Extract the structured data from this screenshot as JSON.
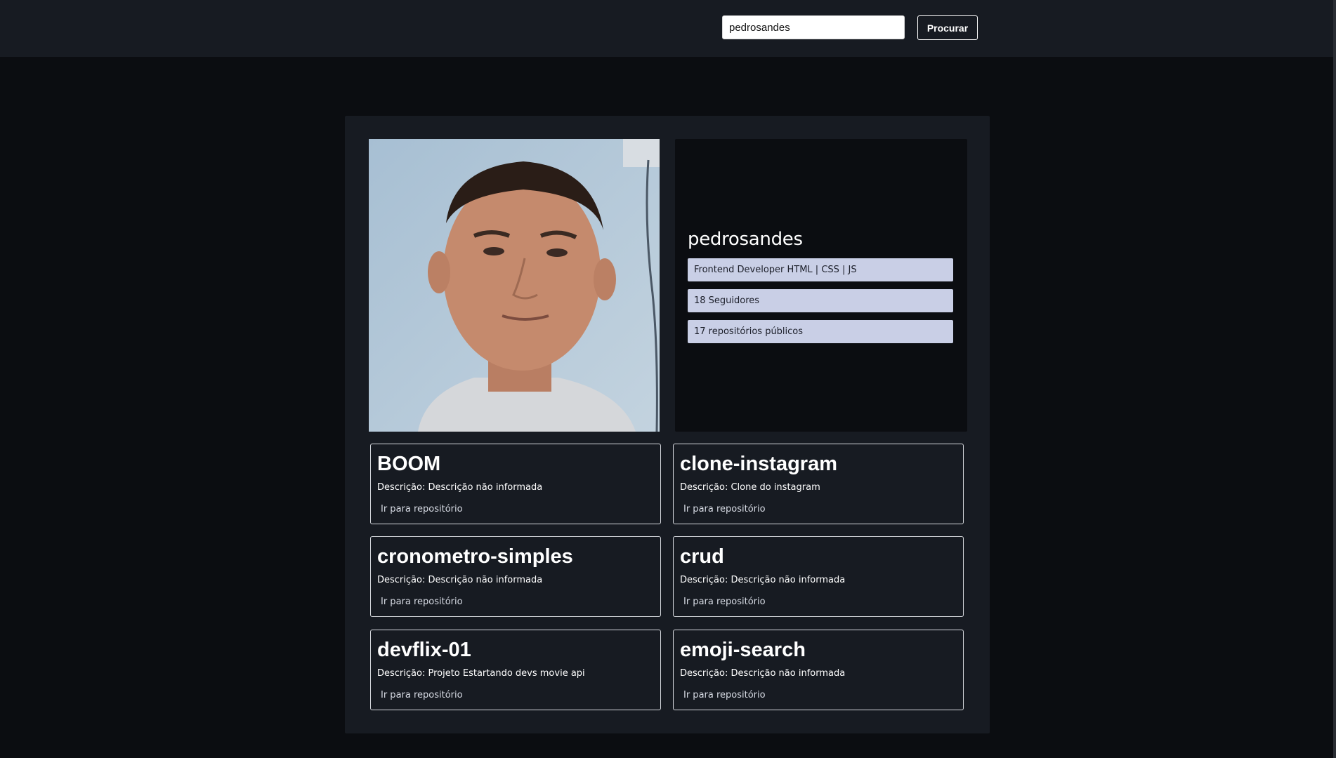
{
  "header": {
    "search_value": "pedrosandes",
    "search_button_label": "Procurar"
  },
  "profile": {
    "photo_icon": "user-avatar-photo",
    "username": "pedrosandes",
    "bio": "Frontend Developer HTML | CSS | JS",
    "followers": "18 Seguidores",
    "public_repos": "17 repositórios públicos"
  },
  "repos": [
    {
      "name": "BOOM",
      "description": "Descrição: Descrição não informada",
      "link_label": "Ir para repositório"
    },
    {
      "name": "clone-instagram",
      "description": "Descrição: Clone do instagram",
      "link_label": "Ir para repositório"
    },
    {
      "name": "cronometro-simples",
      "description": "Descrição: Descrição não informada",
      "link_label": "Ir para repositório"
    },
    {
      "name": "crud",
      "description": "Descrição: Descrição não informada",
      "link_label": "Ir para repositório"
    },
    {
      "name": "devflix-01",
      "description": "Descrição: Projeto Estartando devs movie api",
      "link_label": "Ir para repositório"
    },
    {
      "name": "emoji-search",
      "description": "Descrição: Descrição não informada",
      "link_label": "Ir para repositório"
    }
  ],
  "colors": {
    "page_background": "#0b0d11",
    "header_background": "#171b22",
    "panel_background": "#171b22",
    "pill_background": "#c9cfe6"
  }
}
